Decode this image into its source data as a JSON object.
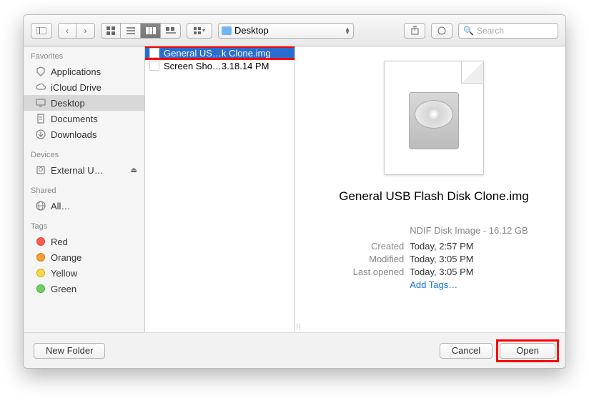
{
  "toolbar": {
    "location": "Desktop",
    "search_placeholder": "Search"
  },
  "sidebar": {
    "sections": [
      {
        "title": "Favorites",
        "items": [
          {
            "label": "Applications",
            "icon": "apps"
          },
          {
            "label": "iCloud Drive",
            "icon": "cloud"
          },
          {
            "label": "Desktop",
            "icon": "desktop",
            "selected": true
          },
          {
            "label": "Documents",
            "icon": "doc"
          },
          {
            "label": "Downloads",
            "icon": "down"
          }
        ]
      },
      {
        "title": "Devices",
        "items": [
          {
            "label": "External U…",
            "icon": "disk",
            "eject": true
          }
        ]
      },
      {
        "title": "Shared",
        "items": [
          {
            "label": "All…",
            "icon": "globe"
          }
        ]
      },
      {
        "title": "Tags",
        "items": [
          {
            "label": "Red",
            "tag": "#ff5c4f"
          },
          {
            "label": "Orange",
            "tag": "#ff9b2f"
          },
          {
            "label": "Yellow",
            "tag": "#ffd93b"
          },
          {
            "label": "Green",
            "tag": "#6cd25a"
          }
        ]
      }
    ]
  },
  "file_list": [
    {
      "name": "General US…k Clone.img",
      "selected": true,
      "highlighted": true
    },
    {
      "name": "Screen Sho…3.18.14 PM"
    }
  ],
  "preview": {
    "title": "General USB Flash Disk Clone.img",
    "subtype": "NDIF Disk Image - 16.12 GB",
    "created_label": "Created",
    "created_value": "Today, 2:57 PM",
    "modified_label": "Modified",
    "modified_value": "Today, 3:05 PM",
    "lastopened_label": "Last opened",
    "lastopened_value": "Today, 3:05 PM",
    "add_tags": "Add Tags…"
  },
  "buttons": {
    "new_folder": "New Folder",
    "cancel": "Cancel",
    "open": "Open"
  }
}
